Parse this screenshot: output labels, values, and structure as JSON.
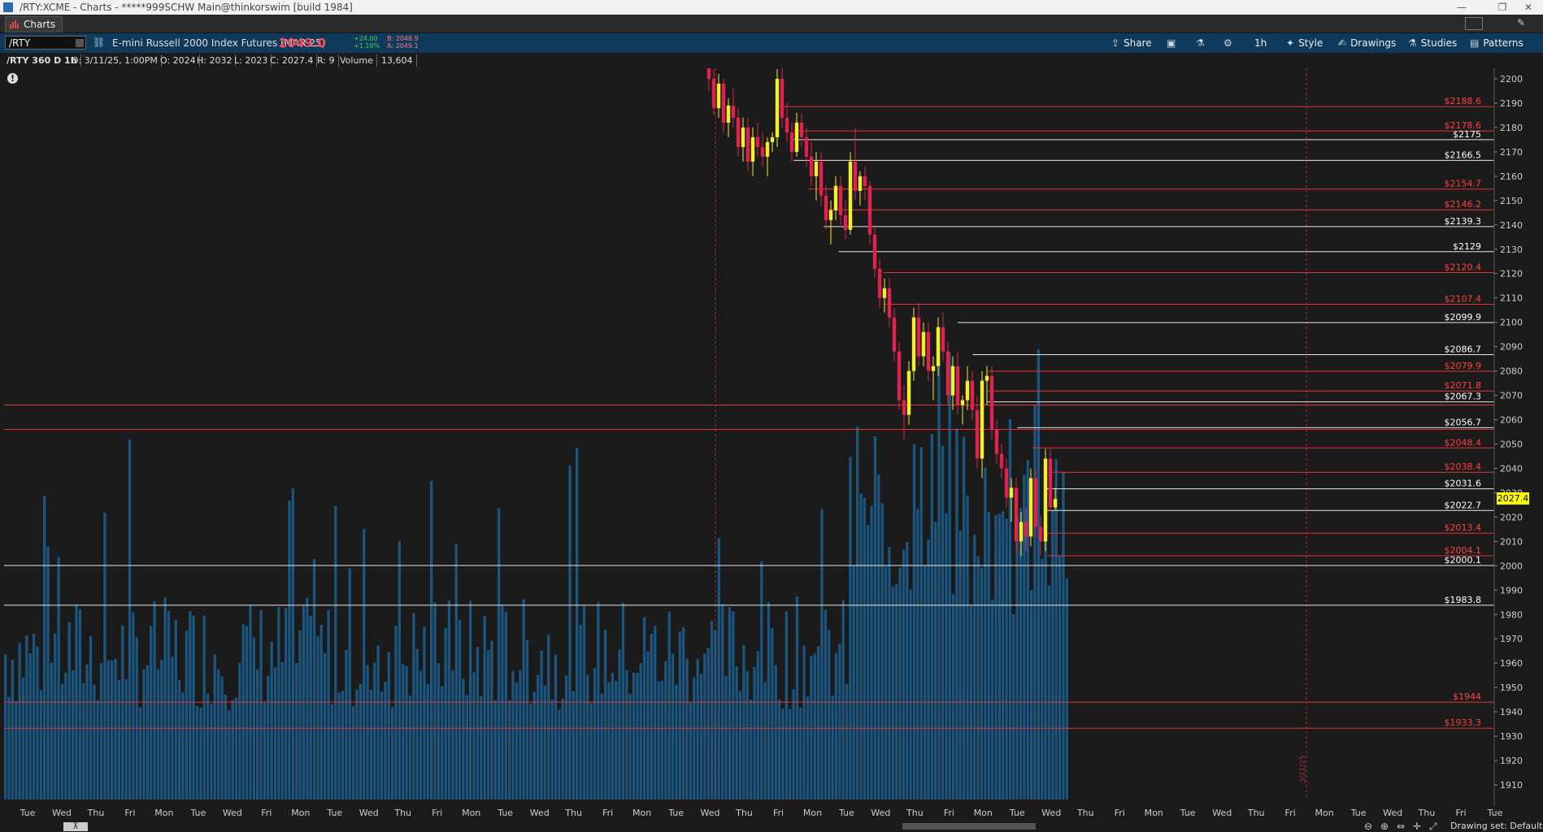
{
  "window": {
    "title": "/RTY:XCME - Charts - *****999SCHW Main@thinkorswim [build 1984]",
    "controls": [
      "—",
      "❐",
      "✕"
    ]
  },
  "tabs": {
    "charts_label": "Charts"
  },
  "toolbar": {
    "symbol": "/RTY",
    "description": "E-mini Russell 2000 Index Futures (MAR 25)",
    "last_price": "2049.0",
    "change": "+24.00",
    "change_pct": "+1.19%",
    "bid": "B: 2048.9",
    "ask": "A: 2049.1",
    "share": "Share",
    "timeframe": "1h",
    "style": "Style",
    "drawings": "Drawings",
    "studies": "Studies",
    "patterns": "Patterns",
    "colors": {
      "bar_bg": "#0f3a5c",
      "last_price": "#ff4d5a",
      "change": "#3fd34f"
    }
  },
  "info": {
    "title": "/RTY 360 D 1h",
    "date": "D: 3/11/25, 1:00PM",
    "open": "O: 2024",
    "high": "H: 2032",
    "low": "L: 2023",
    "close": "C: 2027.4",
    "range": "R: 9",
    "volume_label": "Volume",
    "volume_value": "13,604"
  },
  "chart_data": {
    "type": "candlestick_with_volume",
    "price_axis": {
      "ticks": [
        2200,
        2190,
        2180,
        2170,
        2160,
        2150,
        2140,
        2130,
        2120,
        2110,
        2100,
        2090,
        2080,
        2070,
        2060,
        2050,
        2040,
        2030,
        2020,
        2010,
        2000,
        1990,
        1980,
        1970,
        1960,
        1950,
        1940,
        1930,
        1920,
        1910
      ],
      "range": [
        1904,
        2203
      ]
    },
    "current_price": "2027.4",
    "levels": [
      {
        "label": "$2188.6",
        "value": 2188.6,
        "color": "red",
        "start": 0.52
      },
      {
        "label": "$2178.6",
        "value": 2178.6,
        "color": "red",
        "start": 0.53
      },
      {
        "label": "$2175",
        "value": 2175,
        "color": "white",
        "start": 0.53
      },
      {
        "label": "$2166.5",
        "value": 2166.5,
        "color": "white",
        "start": 0.53
      },
      {
        "label": "$2154.7",
        "value": 2154.7,
        "color": "red",
        "start": 0.54
      },
      {
        "label": "$2146.2",
        "value": 2146.2,
        "color": "red",
        "start": 0.55
      },
      {
        "label": "$2139.3",
        "value": 2139.3,
        "color": "white",
        "start": 0.55
      },
      {
        "label": "$2129",
        "value": 2129,
        "color": "white",
        "start": 0.56
      },
      {
        "label": "$2120.4",
        "value": 2120.4,
        "color": "red",
        "start": 0.59
      },
      {
        "label": "$2107.4",
        "value": 2107.4,
        "color": "red",
        "start": 0.59
      },
      {
        "label": "$2099.9",
        "value": 2099.9,
        "color": "white",
        "start": 0.64
      },
      {
        "label": "$2086.7",
        "value": 2086.7,
        "color": "white",
        "start": 0.65
      },
      {
        "label": "$2079.9",
        "value": 2079.9,
        "color": "red",
        "start": 0.66
      },
      {
        "label": "$2071.8",
        "value": 2071.8,
        "color": "red",
        "start": 0.66
      },
      {
        "label": "$2067.3",
        "value": 2067.3,
        "color": "white",
        "start": 0.66
      },
      {
        "label": "$2066",
        "value": 2066,
        "color": "red",
        "start": 0.0,
        "nolabel": true
      },
      {
        "label": "$2056.7",
        "value": 2056.7,
        "color": "white",
        "start": 0.68
      },
      {
        "label": "$2056",
        "value": 2056,
        "color": "red",
        "start": 0.0,
        "nolabel": true
      },
      {
        "label": "$2048.4",
        "value": 2048.4,
        "color": "red",
        "start": 0.69
      },
      {
        "label": "$2038.4",
        "value": 2038.4,
        "color": "red",
        "start": 0.7
      },
      {
        "label": "$2031.6",
        "value": 2031.6,
        "color": "white",
        "start": 0.7
      },
      {
        "label": "$2022.7",
        "value": 2022.7,
        "color": "white",
        "start": 0.7
      },
      {
        "label": "$2013.4",
        "value": 2013.4,
        "color": "red",
        "start": 0.7
      },
      {
        "label": "$2004.1",
        "value": 2004.1,
        "color": "red",
        "start": 0.7
      },
      {
        "label": "$2000.1",
        "value": 2000.1,
        "color": "white",
        "start": 0.0
      },
      {
        "label": "$1983.8",
        "value": 1983.8,
        "color": "white",
        "start": 0.0
      },
      {
        "label": "$1944",
        "value": 1944,
        "color": "red",
        "start": 0.0
      },
      {
        "label": "$1933.3",
        "value": 1933.3,
        "color": "red",
        "start": 0.0
      }
    ],
    "candles": [
      [
        2205,
        2210,
        2195,
        2200
      ],
      [
        2200,
        2204,
        2185,
        2188
      ],
      [
        2188,
        2202,
        2184,
        2198
      ],
      [
        2198,
        2200,
        2178,
        2182
      ],
      [
        2182,
        2192,
        2176,
        2189
      ],
      [
        2189,
        2196,
        2180,
        2184
      ],
      [
        2184,
        2188,
        2168,
        2172
      ],
      [
        2172,
        2184,
        2166,
        2180
      ],
      [
        2180,
        2184,
        2162,
        2166
      ],
      [
        2166,
        2180,
        2160,
        2176
      ],
      [
        2176,
        2182,
        2168,
        2172
      ],
      [
        2172,
        2178,
        2164,
        2168
      ],
      [
        2168,
        2176,
        2160,
        2174
      ],
      [
        2174,
        2178,
        2170,
        2176
      ],
      [
        2176,
        2204,
        2172,
        2200
      ],
      [
        2200,
        2208,
        2180,
        2184
      ],
      [
        2184,
        2190,
        2174,
        2178
      ],
      [
        2178,
        2182,
        2166,
        2170
      ],
      [
        2170,
        2186,
        2168,
        2182
      ],
      [
        2182,
        2186,
        2172,
        2176
      ],
      [
        2176,
        2180,
        2164,
        2168
      ],
      [
        2168,
        2174,
        2156,
        2160
      ],
      [
        2160,
        2170,
        2150,
        2166
      ],
      [
        2166,
        2170,
        2148,
        2152
      ],
      [
        2152,
        2156,
        2138,
        2142
      ],
      [
        2142,
        2150,
        2132,
        2146
      ],
      [
        2146,
        2160,
        2142,
        2156
      ],
      [
        2156,
        2160,
        2140,
        2144
      ],
      [
        2144,
        2150,
        2134,
        2138
      ],
      [
        2138,
        2170,
        2136,
        2166
      ],
      [
        2166,
        2180,
        2150,
        2154
      ],
      [
        2154,
        2162,
        2148,
        2160
      ],
      [
        2160,
        2164,
        2150,
        2156
      ],
      [
        2156,
        2158,
        2132,
        2136
      ],
      [
        2136,
        2140,
        2118,
        2122
      ],
      [
        2122,
        2126,
        2106,
        2110
      ],
      [
        2110,
        2118,
        2104,
        2114
      ],
      [
        2114,
        2118,
        2098,
        2102
      ],
      [
        2102,
        2106,
        2084,
        2088
      ],
      [
        2088,
        2092,
        2064,
        2068
      ],
      [
        2068,
        2074,
        2052,
        2062
      ],
      [
        2062,
        2084,
        2058,
        2080
      ],
      [
        2080,
        2106,
        2076,
        2102
      ],
      [
        2102,
        2108,
        2082,
        2086
      ],
      [
        2086,
        2100,
        2082,
        2096
      ],
      [
        2096,
        2100,
        2076,
        2080
      ],
      [
        2080,
        2086,
        2068,
        2082
      ],
      [
        2082,
        2102,
        2078,
        2098
      ],
      [
        2098,
        2104,
        2084,
        2088
      ],
      [
        2088,
        2092,
        2066,
        2070
      ],
      [
        2070,
        2086,
        2064,
        2082
      ],
      [
        2082,
        2088,
        2062,
        2066
      ],
      [
        2066,
        2070,
        2058,
        2068
      ],
      [
        2068,
        2082,
        2064,
        2076
      ],
      [
        2076,
        2080,
        2060,
        2064
      ],
      [
        2064,
        2070,
        2040,
        2044
      ],
      [
        2044,
        2080,
        2036,
        2076
      ],
      [
        2076,
        2082,
        2066,
        2078
      ],
      [
        2078,
        2082,
        2052,
        2056
      ],
      [
        2056,
        2060,
        2042,
        2046
      ],
      [
        2046,
        2050,
        2036,
        2040
      ],
      [
        2040,
        2044,
        2024,
        2028
      ],
      [
        2028,
        2036,
        2018,
        2032
      ],
      [
        2032,
        2036,
        2006,
        2010
      ],
      [
        2010,
        2022,
        2004,
        2018
      ],
      [
        2018,
        2024,
        2006,
        2012
      ],
      [
        2012,
        2040,
        2008,
        2036
      ],
      [
        2036,
        2040,
        2012,
        2016
      ],
      [
        2016,
        2020,
        2004,
        2010
      ],
      [
        2010,
        2048,
        2006,
        2044
      ],
      [
        2044,
        2048,
        2022,
        2024
      ],
      [
        2024,
        2032,
        2023,
        2027.4
      ]
    ],
    "volume_bars": 300,
    "time_labels": [
      "Tue",
      "Wed",
      "Thu",
      "Fri",
      "Mon",
      "Tue",
      "Wed",
      "Fri",
      "Mon",
      "Tue",
      "Wed",
      "Thu",
      "Fri",
      "Mon",
      "Tue",
      "Wed",
      "Thu",
      "Fri",
      "Mon",
      "Tue",
      "Wed",
      "Thu",
      "Fri",
      "Mon",
      "Tue",
      "Wed",
      "Thu",
      "Fri",
      "Mon",
      "Tue",
      "Wed",
      "Thu",
      "Fri",
      "Mon",
      "Tue",
      "Wed",
      "Thu",
      "Fri",
      "Mon",
      "Tue",
      "Wed",
      "Thu",
      "Fri",
      "Tue"
    ],
    "session_markers": [
      "3/21/25"
    ]
  },
  "status": {
    "drawing_set": "Drawing set: Default",
    "scroll_left": "⊼"
  }
}
